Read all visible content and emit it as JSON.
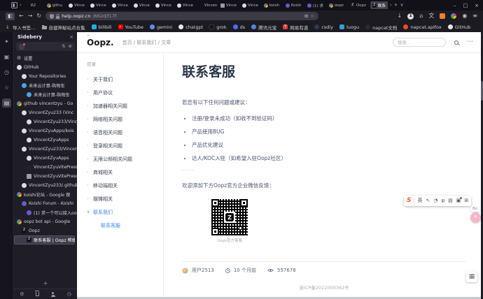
{
  "browser": {
    "tab_strip": {
      "scroll_left": "‹",
      "scroll_right": "›",
      "new_tab": "+",
      "list_tabs": "∨"
    },
    "window_controls": {
      "minimize": "–",
      "maximize": "□",
      "close": "×"
    },
    "tabs": [
      {
        "label": "R2",
        "icon": "none",
        "active": false
      },
      {
        "label": "githu",
        "icon": "google",
        "active": false
      },
      {
        "label": "Vince",
        "icon": "github",
        "active": false
      },
      {
        "label": "Vince",
        "icon": "github",
        "active": false
      },
      {
        "label": "Vince",
        "icon": "github",
        "active": false
      },
      {
        "label": "Vince",
        "icon": "github",
        "active": false
      },
      {
        "label": "Vince",
        "icon": "github",
        "active": false
      },
      {
        "label": "Vince",
        "icon": "github",
        "active": false
      },
      {
        "label": "Vincent2",
        "icon": "none",
        "active": false
      },
      {
        "label": "Vince",
        "icon": "image",
        "active": false
      },
      {
        "label": "Vince",
        "icon": "github",
        "active": false
      },
      {
        "label": "koish",
        "icon": "google",
        "active": false
      },
      {
        "label": "Koish",
        "icon": "koishi",
        "active": false
      },
      {
        "label": "(1) 求",
        "icon": "koishi",
        "active": false
      },
      {
        "label": "oopz",
        "icon": "google",
        "active": false
      },
      {
        "label": "Oopz",
        "icon": "oopz",
        "active": false
      },
      {
        "label": "联系",
        "icon": "oopz",
        "active": true
      }
    ],
    "nav": {
      "back": "←",
      "forward": "→",
      "reload": "↻",
      "sidebar_toggle": "◧",
      "url_domain": "help.oopz.cn",
      "url_path": "/662d/f17f",
      "url_action_icons": [
        {
          "name": "save-page-icon",
          "glyph": "⊞"
        },
        {
          "name": "bookmark-star-icon",
          "glyph": "☆"
        }
      ],
      "toolbar_icons": [
        {
          "name": "downloads-icon",
          "glyph": "↓"
        },
        {
          "name": "extension-badge-icon",
          "glyph": "1"
        },
        {
          "name": "home-icon",
          "glyph": "⌂"
        },
        {
          "name": "translate-icon",
          "glyph": "文"
        },
        {
          "name": "extension-orange-icon",
          "glyph": ""
        },
        {
          "name": "extension-colorful-icon",
          "glyph": ""
        },
        {
          "name": "account-icon",
          "glyph": "◉"
        },
        {
          "name": "menu-icon",
          "glyph": "≡"
        }
      ]
    },
    "bookmarks": [
      {
        "label": "导入书签…",
        "icon": "import"
      },
      {
        "label": "自建神秘站点合集",
        "icon": "folder"
      },
      {
        "label": "bilibili",
        "icon": "bilibili"
      },
      {
        "label": "YouTube",
        "icon": "youtube"
      },
      {
        "label": "gemini",
        "icon": "gemini"
      },
      {
        "label": "chatgpt",
        "icon": "chatgpt"
      },
      {
        "label": "grok",
        "icon": "grok"
      },
      {
        "label": "ds",
        "icon": "deepseek"
      },
      {
        "label": "腾讯元宝",
        "icon": "yuanbao"
      },
      {
        "label": "网易有道",
        "icon": "youdao"
      },
      {
        "label": "csdiy",
        "icon": "csdiy"
      },
      {
        "label": "luogu",
        "icon": "luogu"
      },
      {
        "label": "napcat文档",
        "icon": "napcat"
      },
      {
        "label": "napcat.apifox",
        "icon": "apifox"
      },
      {
        "label": "GitHub",
        "icon": "github"
      }
    ]
  },
  "sidebar": {
    "strip_icons": [
      {
        "name": "ai-chatbot-icon",
        "glyph": "✦",
        "active": false
      },
      {
        "name": "synced-tabs-icon",
        "glyph": "▣",
        "active": false
      },
      {
        "name": "history-icon",
        "glyph": "◷",
        "active": false
      },
      {
        "name": "bookmarks-icon",
        "glyph": "☆",
        "active": false
      },
      {
        "name": "sidebery-panel-icon",
        "glyph": "▤",
        "active": true
      }
    ],
    "title": "Sidebery",
    "close": "×",
    "panel_toolbar_icons": [
      {
        "name": "sort-icon",
        "glyph": "⇅"
      },
      {
        "name": "dismiss-icon",
        "glyph": "⊗"
      }
    ],
    "tree": [
      {
        "label": "设置",
        "icon": "gear",
        "depth": 0,
        "active": false
      },
      {
        "label": "GitHub",
        "icon": "github",
        "depth": 0,
        "active": false
      },
      {
        "label": "Your Repositories",
        "icon": "github",
        "depth": 1,
        "active": false
      },
      {
        "label": "未来云计算-购物车",
        "icon": "cloud",
        "depth": 1,
        "active": false
      },
      {
        "label": "未来云计算-购物车",
        "icon": "cloud",
        "depth": 2,
        "active": false
      },
      {
        "label": "github vincentzyu - Go",
        "icon": "google",
        "depth": 0,
        "active": false
      },
      {
        "label": "VincentZyu233 (Vinc",
        "icon": "github",
        "depth": 1,
        "active": false
      },
      {
        "label": "VincentZyu233/Vinc",
        "icon": "github",
        "depth": 2,
        "active": false
      },
      {
        "label": "VincentZyuApps/kois",
        "icon": "github",
        "depth": 1,
        "active": false
      },
      {
        "label": "VincentZyuApps",
        "icon": "github",
        "depth": 2,
        "active": false
      },
      {
        "label": "VincentZyu233/Vincen",
        "icon": "github",
        "depth": 1,
        "active": false
      },
      {
        "label": "VincentZyuApps",
        "icon": "github",
        "depth": 2,
        "active": false
      },
      {
        "label": "VincentZyuVitePress",
        "icon": "vitepress",
        "depth": 2,
        "active": false
      },
      {
        "label": "VincentZyuVitePress",
        "icon": "image",
        "depth": 2,
        "active": false
      },
      {
        "label": "VincentZyu233/.github",
        "icon": "github",
        "depth": 1,
        "active": false
      },
      {
        "label": "koishi论坛 - Google 搜",
        "icon": "google",
        "depth": 0,
        "active": false
      },
      {
        "label": "Koishi Forum - Koishi",
        "icon": "koishi",
        "depth": 1,
        "active": false
      },
      {
        "label": "(1) 求一个可以接入oo",
        "icon": "koishi",
        "depth": 2,
        "active": false
      },
      {
        "label": "oopz bot api - Google",
        "icon": "google",
        "depth": 0,
        "active": false
      },
      {
        "label": "Oopz",
        "icon": "oopz",
        "depth": 1,
        "active": false
      },
      {
        "label": "联系客服 | Oopz 帮助",
        "icon": "oopz",
        "depth": 2,
        "active": true
      }
    ],
    "new_tab": "+",
    "bottom_icons": [
      {
        "name": "settings-icon",
        "glyph": "⚙"
      },
      {
        "name": "trash-icon",
        "glyph": ""
      },
      {
        "name": "person-icon",
        "glyph": ""
      },
      {
        "name": "history-clock-icon",
        "glyph": "◷"
      }
    ]
  },
  "page": {
    "logo": "Oopz.",
    "breadcrumb": "首页 / 联系我们 / 文章",
    "search_placeholder": "搜索...",
    "more_button": "⋯",
    "toc": {
      "title": "目录",
      "items": [
        {
          "label": "关于我们",
          "chevron": "›",
          "active": false,
          "child": false
        },
        {
          "label": "用户协议",
          "chevron": "›",
          "active": false,
          "child": false
        },
        {
          "label": "加速器相关问题",
          "chevron": "›",
          "active": false,
          "child": false
        },
        {
          "label": "网络相关问题",
          "chevron": "›",
          "active": false,
          "child": false
        },
        {
          "label": "语音相关问题",
          "chevron": "›",
          "active": false,
          "child": false
        },
        {
          "label": "登录相关问题",
          "chevron": "›",
          "active": false,
          "child": false
        },
        {
          "label": "无限公频相关问题",
          "chevron": "›",
          "active": false,
          "child": false
        },
        {
          "label": "商城相关",
          "chevron": "›",
          "active": false,
          "child": false
        },
        {
          "label": "移动端相关",
          "chevron": "›",
          "active": false,
          "child": false
        },
        {
          "label": "摆摊相关",
          "chevron": "›",
          "active": false,
          "child": false
        },
        {
          "label": "联系我们",
          "chevron": "∨",
          "active": true,
          "child": false
        },
        {
          "label": "联系客服",
          "chevron": "",
          "active": true,
          "child": true
        }
      ]
    },
    "article": {
      "title": "联系客服",
      "intro": "若您有以下任何问题或建议：",
      "bullets": [
        {
          "label": "注册/登录未成功（如收不到验证码）"
        },
        {
          "label": "产品使用BUG"
        },
        {
          "label": "产品优化建议"
        },
        {
          "label": "达人/KOC入驻（如希望入驻Oopz社区）"
        }
      ],
      "divider": "-----",
      "note": "欢迎添加下方Oopz官方企业微信反馈：",
      "qr_caption": "Oopz官方客服",
      "meta": {
        "author": "用户2513",
        "time": "10 个月前",
        "views": "557678"
      },
      "footer": "浙ICP备2022009362号"
    }
  },
  "overlay": {
    "toolbar_logo": "S",
    "toolbar_icons": [
      {
        "name": "translate-en-icon",
        "glyph": "英",
        "badge": false
      },
      {
        "name": "cursor-icon",
        "glyph": "↖",
        "badge": false
      },
      {
        "name": "clock-face-icon",
        "glyph": "◔",
        "badge": false
      },
      {
        "name": "microphone-icon",
        "glyph": "ψ",
        "badge": false
      },
      {
        "name": "keyboard-icon",
        "glyph": "▤",
        "badge": false
      },
      {
        "name": "screenshot-icon",
        "glyph": "▣",
        "badge": true
      },
      {
        "name": "grid-more-icon",
        "glyph": "⊞",
        "badge": false
      }
    ],
    "bo_label": "Bo",
    "pink_fab_glyph": "*",
    "qr_fab_glyph": "▦"
  }
}
